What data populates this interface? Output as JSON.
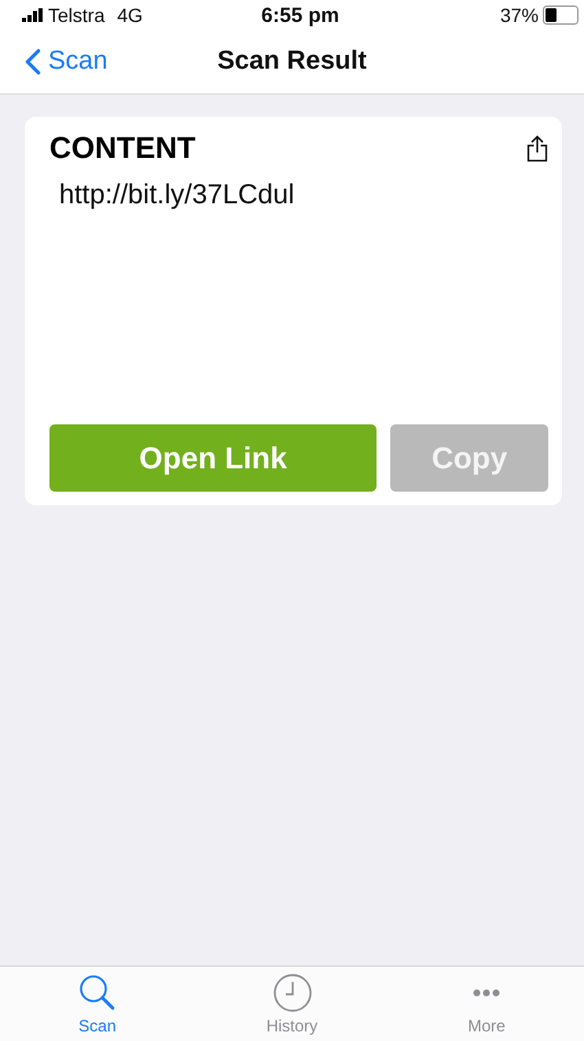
{
  "status_bar": {
    "carrier": "Telstra",
    "network": "4G",
    "time": "6:55 pm",
    "battery_text": "37%"
  },
  "nav_bar": {
    "back_label": "Scan",
    "title": "Scan Result"
  },
  "result_card": {
    "heading": "CONTENT",
    "content": "http://bit.ly/37LCdul",
    "buttons": [
      {
        "label": "Open Link",
        "kind": "primary",
        "disabled": false
      },
      {
        "label": "Copy",
        "kind": "secondary",
        "disabled": true
      }
    ]
  },
  "tab_bar": [
    {
      "label": "Scan",
      "kind": "search",
      "selected": true
    },
    {
      "label": "History",
      "kind": "clock",
      "selected": false
    },
    {
      "label": "More",
      "kind": "more",
      "selected": false
    }
  ]
}
